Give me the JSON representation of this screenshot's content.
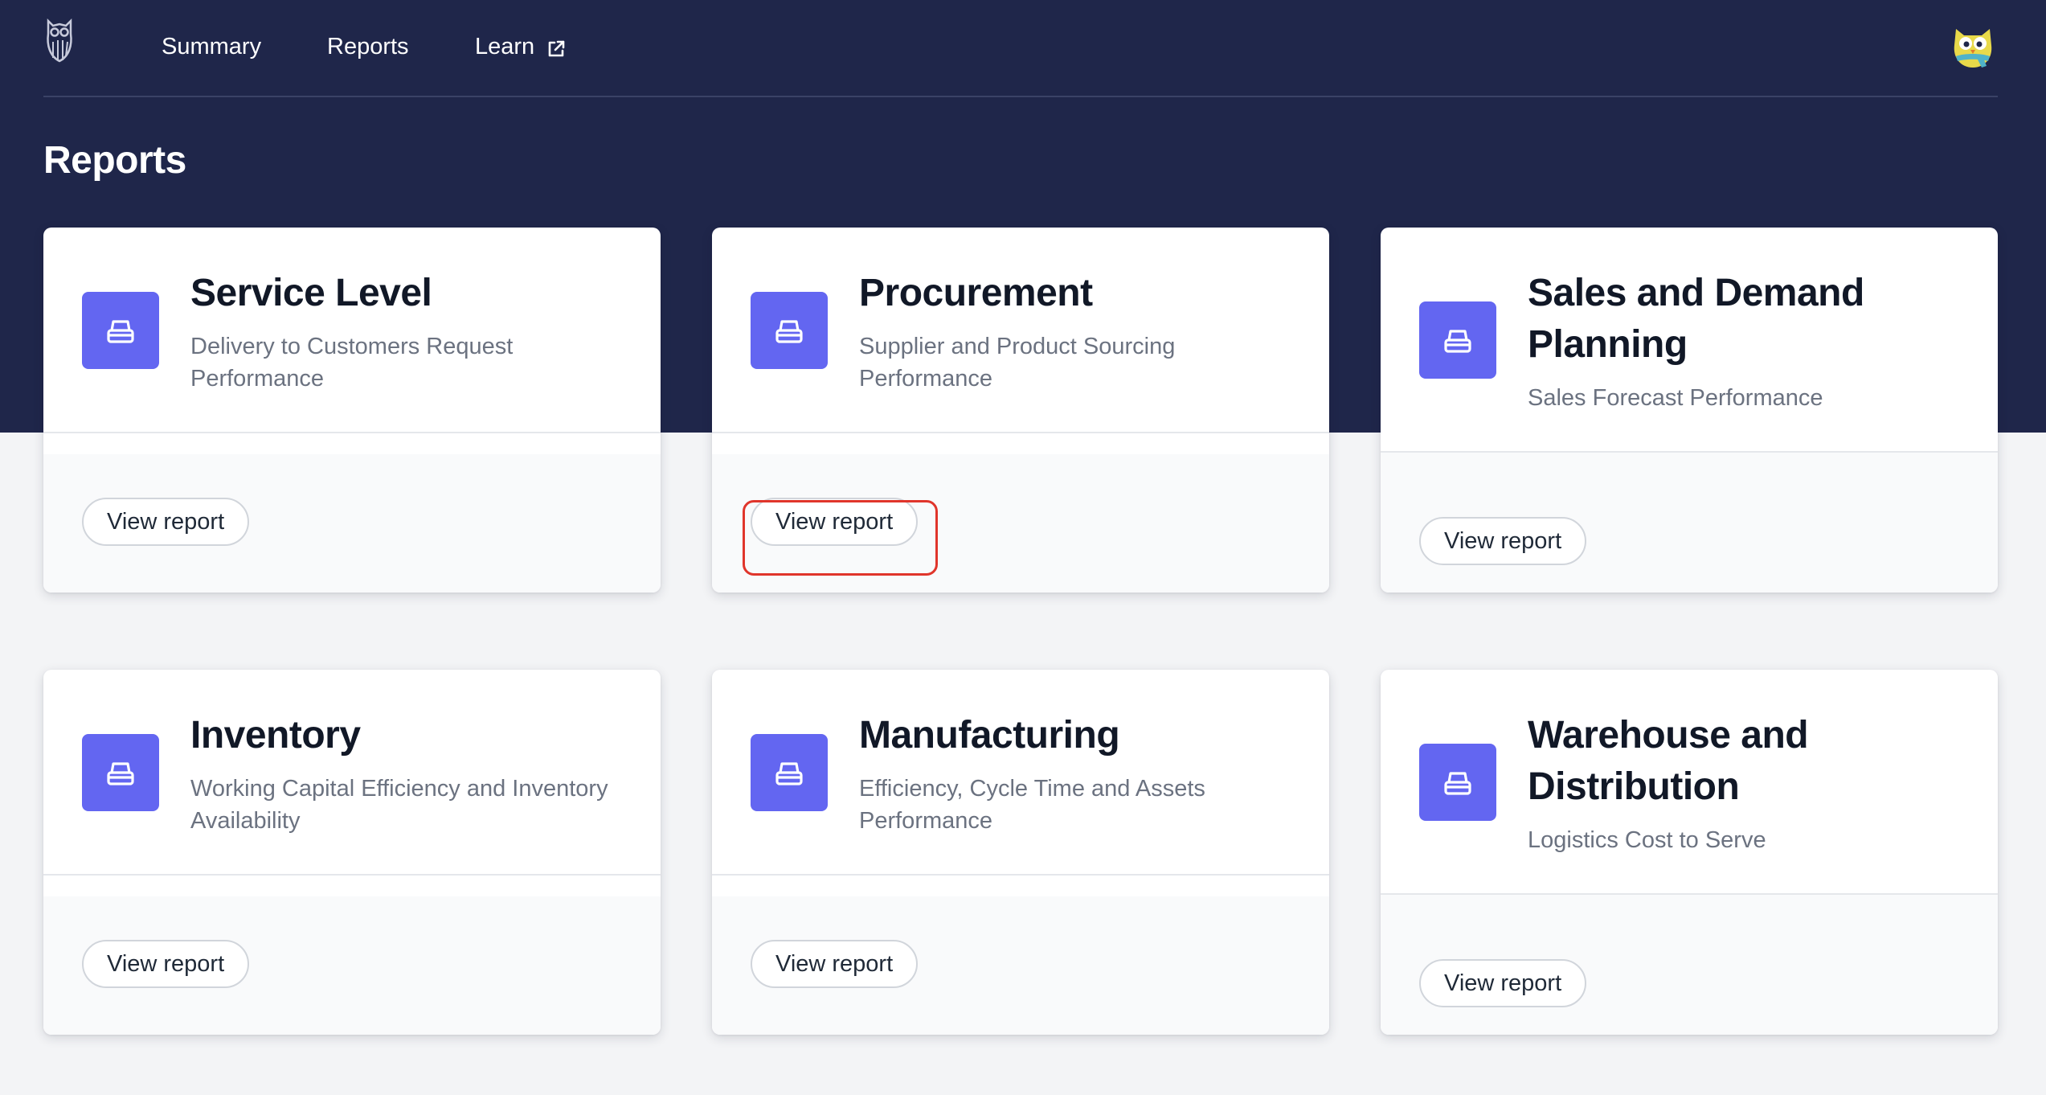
{
  "nav": {
    "links": [
      "Summary",
      "Reports",
      "Learn"
    ]
  },
  "page": {
    "title": "Reports"
  },
  "cards": [
    {
      "title": "Service Level",
      "description": "Delivery to Customers Request Performance",
      "button": "View report"
    },
    {
      "title": "Procurement",
      "description": "Supplier and Product Sourcing Performance",
      "button": "View report"
    },
    {
      "title": "Sales and Demand Planning",
      "description": "Sales Forecast Performance",
      "button": "View report"
    },
    {
      "title": "Inventory",
      "description": "Working Capital Efficiency and Inventory Availability",
      "button": "View report"
    },
    {
      "title": "Manufacturing",
      "description": "Efficiency, Cycle Time and Assets Performance",
      "button": "View report"
    },
    {
      "title": "Warehouse and Distribution",
      "description": "Logistics Cost to Serve",
      "button": "View report"
    }
  ],
  "colors": {
    "header_bg": "#1f264a",
    "icon_bg": "#6366f1",
    "highlight": "#e0352b"
  },
  "icons": {
    "logo": "owl-logo-icon",
    "external": "external-link-icon",
    "avatar": "owl-avatar-icon",
    "card": "inbox-tray-icon"
  }
}
